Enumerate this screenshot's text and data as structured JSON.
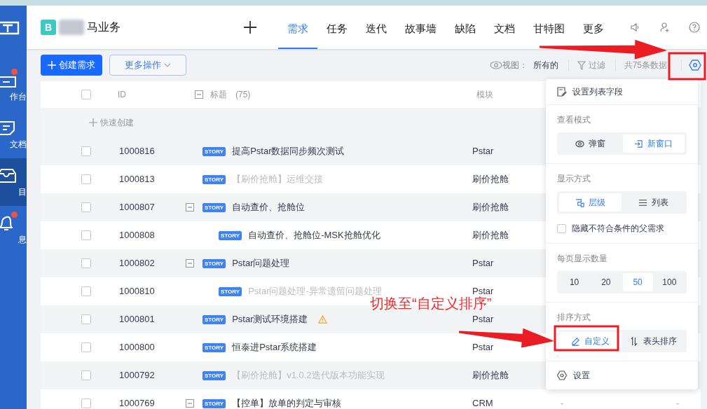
{
  "sidebar": {
    "items": [
      {
        "label": "作台",
        "selected": false,
        "notification": true
      },
      {
        "label": "文档",
        "selected": false,
        "notification": false
      },
      {
        "label": "目",
        "selected": true,
        "notification": false
      },
      {
        "label": "息",
        "selected": false,
        "notification": true
      }
    ]
  },
  "project": {
    "badge": "B",
    "name": "马业务"
  },
  "nav_tabs": [
    {
      "label": "需求",
      "selected": true
    },
    {
      "label": "任务",
      "selected": false
    },
    {
      "label": "迭代",
      "selected": false
    },
    {
      "label": "故事墙",
      "selected": false
    },
    {
      "label": "缺陷",
      "selected": false
    },
    {
      "label": "文档",
      "selected": false
    },
    {
      "label": "甘特图",
      "selected": false
    },
    {
      "label": "更多",
      "selected": false
    }
  ],
  "toolbar": {
    "create_button": "创建需求",
    "more_button": "更多操作",
    "view_label": "视图：",
    "view_value": "所有的",
    "filter": "过滤",
    "count": "共75条数据"
  },
  "table": {
    "select_all_checked": false,
    "columns": [
      {
        "label": "ID"
      },
      {
        "label": "标题",
        "count": "(75)"
      },
      {
        "label": "模块"
      }
    ],
    "quick_create": "快速创建",
    "rows": [
      {
        "id": "1000816",
        "checked": false,
        "tag": "STORY",
        "title": "提高Pstar数据同步频次测试",
        "module": "Pstar",
        "dimmed": false,
        "warning": false
      },
      {
        "id": "1000813",
        "checked": false,
        "tag": "STORY",
        "title": "【刷价抢舱】运维交接",
        "module": "刷价抢舱",
        "dimmed": true,
        "warning": false
      },
      {
        "id": "1000807",
        "checked": false,
        "tag": "STORY",
        "title": "自动查价、抢舱位",
        "module": "刷价抢舱",
        "dimmed": false,
        "warning": false,
        "expanded": true,
        "children": [
          {
            "id": "1000808",
            "checked": false,
            "tag": "STORY",
            "title": "自动查价、抢舱位-MSK抢舱优化",
            "module": "刷价抢舱",
            "dimmed": false,
            "warning": false
          }
        ]
      },
      {
        "id": "1000802",
        "checked": false,
        "tag": "STORY",
        "title": "Pstar问题处理",
        "module": "Pstar",
        "dimmed": false,
        "warning": false,
        "expanded": true,
        "children": [
          {
            "id": "1000810",
            "checked": false,
            "tag": "STORY",
            "title": "Pstar问题处理-异常遗留问题处理",
            "module": "Pstar",
            "dimmed": true,
            "warning": false
          }
        ]
      },
      {
        "id": "1000801",
        "checked": false,
        "tag": "STORY",
        "title": "Pstar测试环境搭建",
        "module": "Pstar",
        "dimmed": false,
        "warning": true
      },
      {
        "id": "1000800",
        "checked": false,
        "tag": "STORY",
        "title": "恒泰进Pstar系统搭建",
        "module": "Pstar",
        "dimmed": false,
        "warning": false
      },
      {
        "id": "1000792",
        "checked": false,
        "tag": "STORY",
        "title": "【刷价抢舱】v1.0.2迭代版本功能实现",
        "module": "刷价抢舱",
        "dimmed": true,
        "warning": false
      },
      {
        "id": "1000769",
        "checked": false,
        "tag": "STORY",
        "title": "【控单】放单的判定与审核",
        "module": "CRM",
        "dimmed": false,
        "warning": false,
        "expanded": true,
        "column_3": "-",
        "column_4": "-"
      }
    ]
  },
  "settings_menu": {
    "field_settings": "设置列表字段",
    "sections": [
      {
        "title": "查看模式",
        "options": [
          {
            "label": "弹窗",
            "selected": false
          },
          {
            "label": "新窗口",
            "selected": true
          }
        ]
      },
      {
        "title": "显示方式",
        "options": [
          {
            "label": "层级",
            "selected": true
          },
          {
            "label": "列表",
            "selected": false
          }
        ],
        "checkbox": {
          "label": "隐藏不符合条件的父需求",
          "checked": false
        }
      },
      {
        "title": "每页显示数量",
        "options": [
          {
            "label": "10",
            "selected": false
          },
          {
            "label": "20",
            "selected": false
          },
          {
            "label": "50",
            "selected": true
          },
          {
            "label": "100",
            "selected": false
          }
        ]
      },
      {
        "title": "排序方式",
        "options": [
          {
            "label": "自定义",
            "selected": true
          },
          {
            "label": "表头排序",
            "selected": false
          }
        ]
      }
    ],
    "settings": "设置"
  },
  "annotation": {
    "text": "切换至“自定义排序”"
  }
}
